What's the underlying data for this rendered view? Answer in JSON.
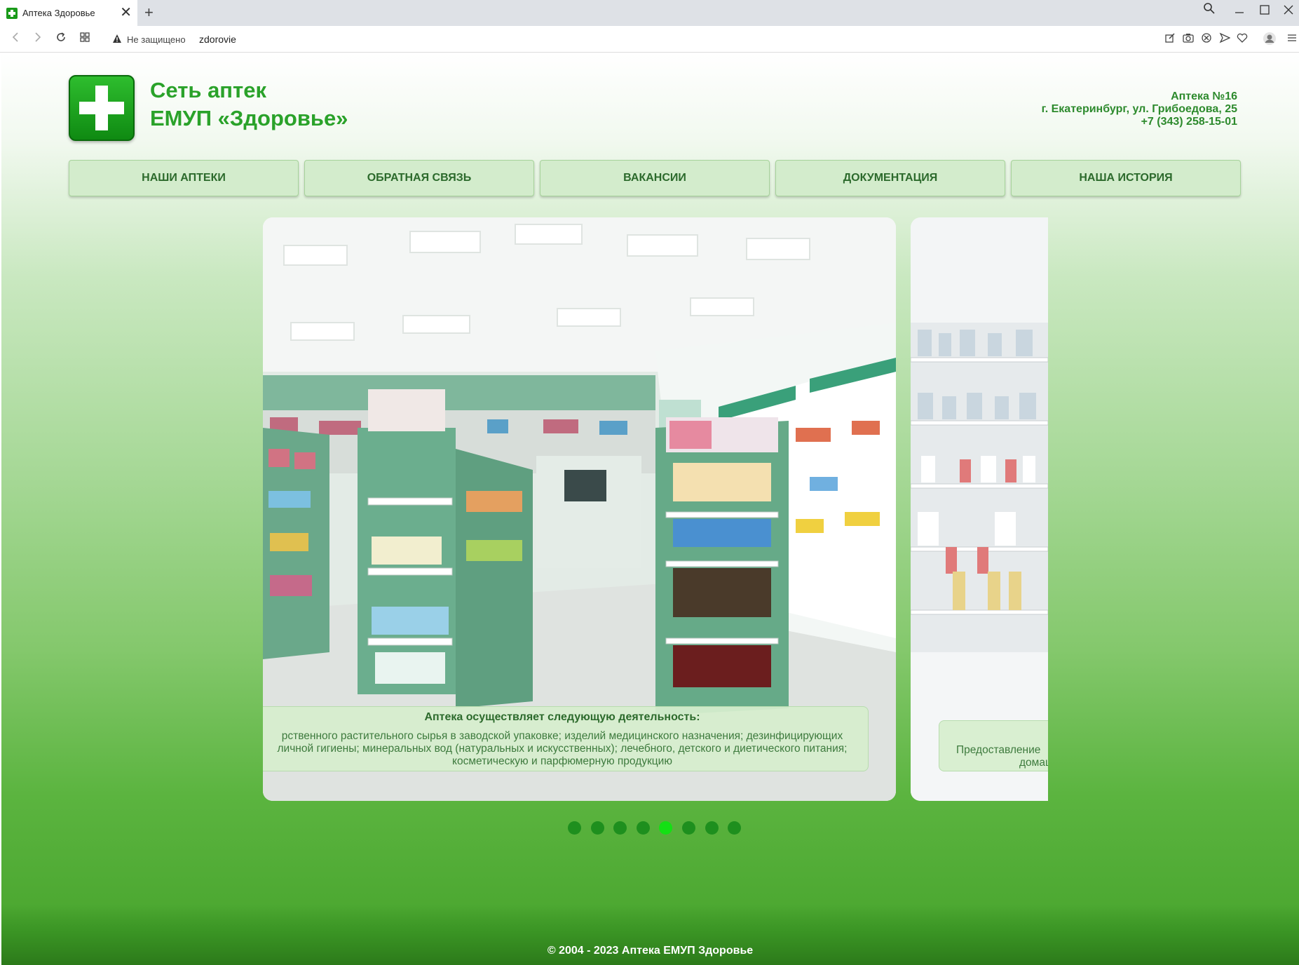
{
  "browser": {
    "tab_title": "Аптека Здоровье",
    "tab_close": "✕",
    "new_tab": "+",
    "not_secure": "Не защищено",
    "url": "zdorovie"
  },
  "site": {
    "title_line1": "Сеть аптек",
    "title_line2": "ЕМУП «Здоровье»"
  },
  "contact": {
    "pharmacy": "Аптека №16",
    "address": "г. Екатеринбург, ул. Грибоедова, 25",
    "phone": "+7 (343) 258-15-01"
  },
  "menu": [
    {
      "label": "НАШИ АПТЕКИ"
    },
    {
      "label": "ОБРАТНАЯ СВЯЗЬ"
    },
    {
      "label": "ВАКАНСИИ"
    },
    {
      "label": "ДОКУМЕНТАЦИЯ"
    },
    {
      "label": "НАША ИСТОРИЯ"
    }
  ],
  "carousel": {
    "active_index": 4,
    "dot_count": 8,
    "current": {
      "title": "Аптека осуществляет следующую деятельность:",
      "line1": "рственного растительного сырья в заводской упаковке; изделий медицинского назначения; дезинфицирующих",
      "line2": "личной гигиены; минеральных вод (натуральных и искусственных); лечебного, детского и диетического питания;",
      "line3": "косметическую и парфюмерную продукцию"
    },
    "next": {
      "line1": "Предоставление",
      "line2": "домаш"
    }
  },
  "footer": {
    "text": "©  2004 - 2023  Аптека ЕМУП Здоровье"
  }
}
